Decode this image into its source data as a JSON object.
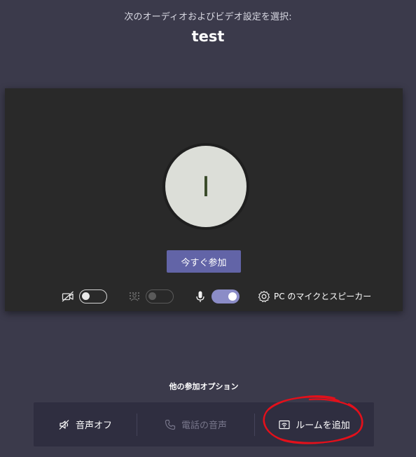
{
  "header": {
    "subtitle": "次のオーディオおよびビデオ設定を選択:",
    "meeting_title": "test"
  },
  "preview": {
    "avatar_initial": "I",
    "join_label": "今すぐ参加"
  },
  "controls": {
    "camera_on": false,
    "background_blur_on": false,
    "background_blur_enabled": false,
    "microphone_on": true,
    "device_label": "PC のマイクとスピーカー"
  },
  "other_options": {
    "title": "他の参加オプション",
    "items": [
      {
        "label": "音声オフ",
        "icon": "speaker-off-icon",
        "enabled": true
      },
      {
        "label": "電話の音声",
        "icon": "phone-icon",
        "enabled": false
      },
      {
        "label": "ルームを追加",
        "icon": "cast-room-icon",
        "enabled": true
      }
    ]
  },
  "annotation": {
    "color": "#e3101b",
    "highlighted_item": "ルームを追加"
  },
  "colors": {
    "background": "#3b3a4b",
    "preview_background": "#292929",
    "accent": "#6264a7",
    "toggle_on": "#8b8cc7"
  }
}
